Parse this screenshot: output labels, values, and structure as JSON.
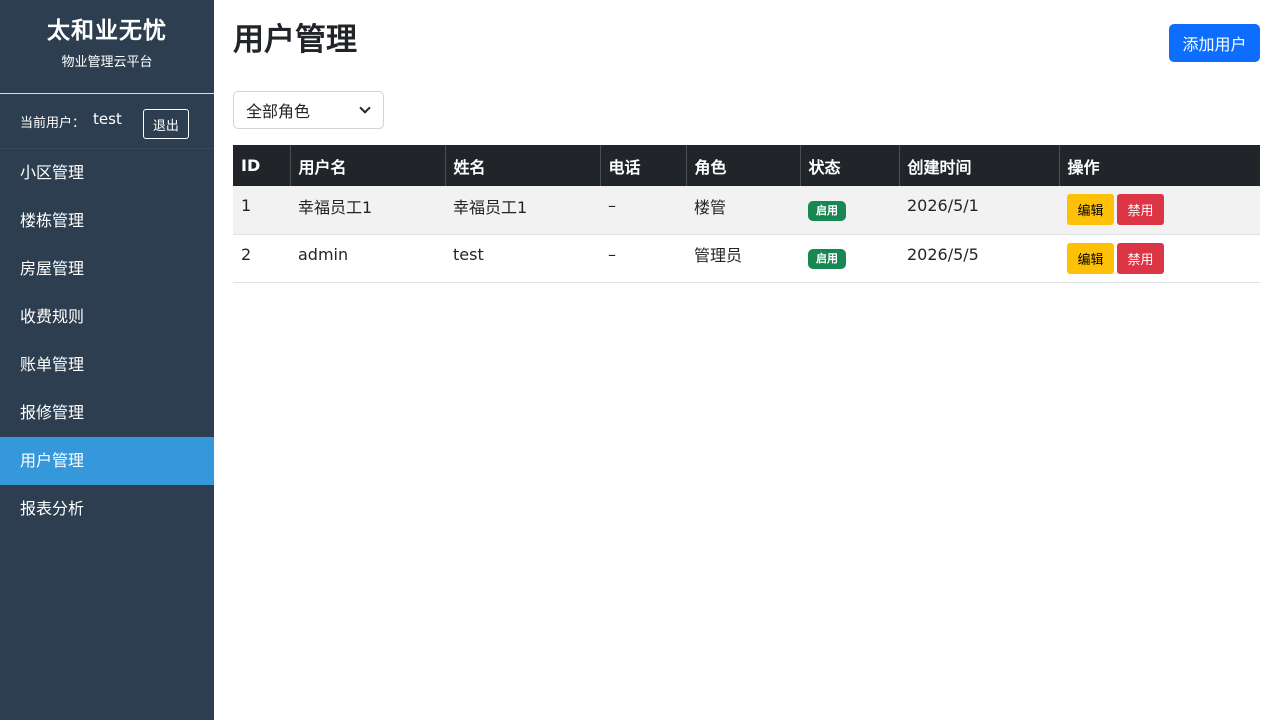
{
  "sidebar": {
    "brand_title": "太和业无忧",
    "brand_subtitle": "物业管理云平台",
    "current_user_label": "当前用户：",
    "current_user_name": "test",
    "logout_label": "退出",
    "items": [
      {
        "label": "小区管理",
        "active": false
      },
      {
        "label": "楼栋管理",
        "active": false
      },
      {
        "label": "房屋管理",
        "active": false
      },
      {
        "label": "收费规则",
        "active": false
      },
      {
        "label": "账单管理",
        "active": false
      },
      {
        "label": "报修管理",
        "active": false
      },
      {
        "label": "用户管理",
        "active": true
      },
      {
        "label": "报表分析",
        "active": false
      }
    ]
  },
  "main": {
    "title": "用户管理",
    "add_button": "添加用户",
    "role_filter": "全部角色"
  },
  "table": {
    "headers": [
      "ID",
      "用户名",
      "姓名",
      "电话",
      "角色",
      "状态",
      "创建时间",
      "操作"
    ],
    "rows": [
      {
        "id": "1",
        "username": "幸福员工1",
        "name": "幸福员工1",
        "phone": "–",
        "role": "楼管",
        "status": "启用",
        "created": "2026/5/1",
        "edit": "编辑",
        "disable": "禁用"
      },
      {
        "id": "2",
        "username": "admin",
        "name": "test",
        "phone": "–",
        "role": "管理员",
        "status": "启用",
        "created": "2026/5/5",
        "edit": "编辑",
        "disable": "禁用"
      }
    ]
  },
  "colors": {
    "sidebar_bg": "#2c3e50",
    "sidebar_active": "#3498db",
    "primary": "#0d6efd",
    "warning": "#ffc107",
    "danger": "#dc3545",
    "success": "#198754"
  },
  "icons": {
    "filter_dropdown": "chevron-down-icon"
  }
}
